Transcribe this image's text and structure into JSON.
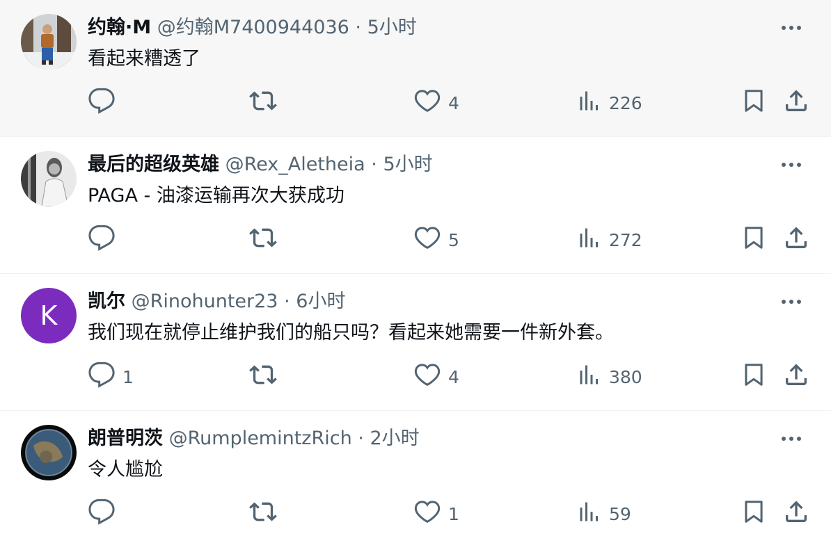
{
  "tweets": [
    {
      "name": "约翰·M",
      "handle": "@约翰M7400944036",
      "dot": "·",
      "time": "5小时",
      "text": "看起来糟透了",
      "replies": "",
      "likes": "4",
      "views": "226"
    },
    {
      "name": "最后的超级英雄",
      "handle": "@Rex_Aletheia",
      "dot": "·",
      "time": "5小时",
      "text": "PAGA - 油漆运输再次大获成功",
      "replies": "",
      "likes": "5",
      "views": "272"
    },
    {
      "name": "凯尔",
      "handle": "@Rinohunter23",
      "dot": "·",
      "time": "6小时",
      "text": "我们现在就停止维护我们的船只吗？看起来她需要一件新外套。",
      "replies": "1",
      "likes": "4",
      "views": "380",
      "avatar_letter": "K"
    },
    {
      "name": "朗普明茨",
      "handle": "@RumplemintzRich",
      "dot": "·",
      "time": "2小时",
      "text": "令人尴尬",
      "replies": "",
      "likes": "1",
      "views": "59"
    }
  ],
  "colors": {
    "muted": "#536471",
    "avatar_k_bg": "#7b2cbf",
    "hover_bg": "#f7f7f7"
  },
  "icons": [
    "more-icon",
    "reply-icon",
    "retweet-icon",
    "like-icon",
    "views-icon",
    "bookmark-icon",
    "share-icon"
  ]
}
